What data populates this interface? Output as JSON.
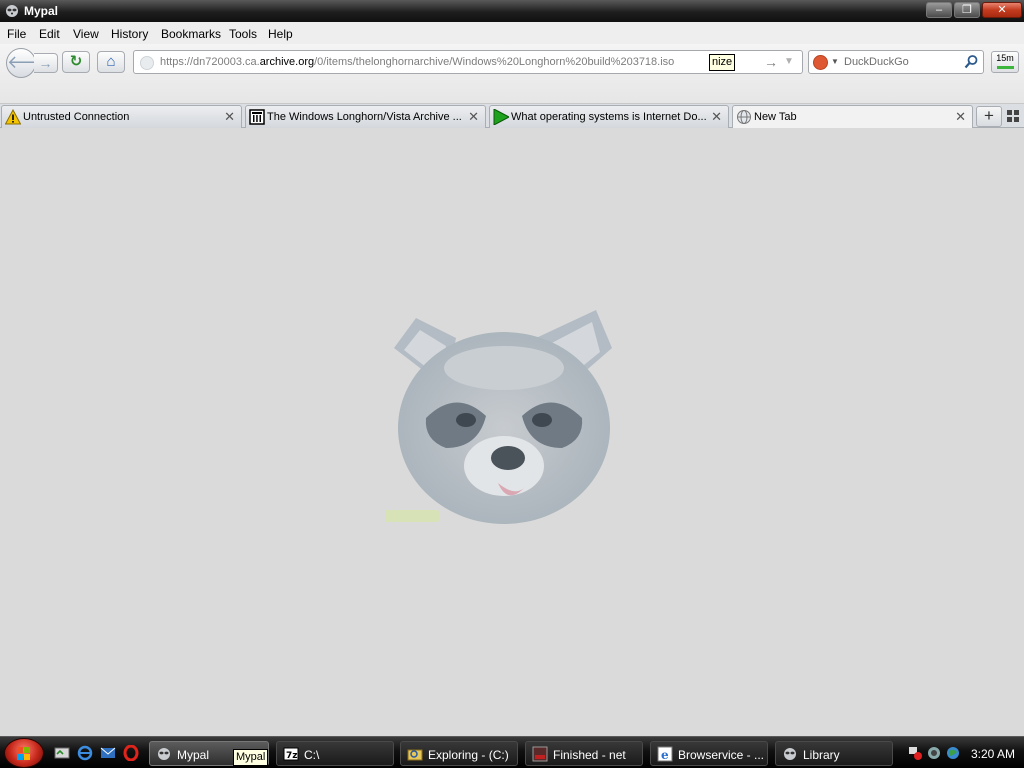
{
  "window": {
    "title": "Mypal",
    "buttons": {
      "minimize": "–",
      "restore": "❐",
      "close": "✕"
    }
  },
  "menubar": {
    "items": [
      "File",
      "Edit",
      "View",
      "History",
      "Bookmarks",
      "Tools",
      "Help"
    ]
  },
  "navbar": {
    "back_glyph": "🡐",
    "forward_glyph": "→",
    "reload_glyph": "↻",
    "home_glyph": "⌂",
    "url_prefix": "https://dn720003.ca.",
    "url_host": "archive.org",
    "url_path": "/0/items/thelonghornarchive/Windows%20Longhorn%20build%203718.iso",
    "url_tooltip": "nize",
    "go_glyph": "→",
    "dropdown_glyph": "▼",
    "search_placeholder": "DuckDuckGo",
    "addon_label": "15m"
  },
  "tabs": [
    {
      "label": "Untrusted Connection",
      "icon": "warning-icon",
      "active": false
    },
    {
      "label": "The Windows Longhorn/Vista Archive ...",
      "icon": "archive-icon",
      "active": false
    },
    {
      "label": "What operating systems is Internet Do...",
      "icon": "play-arrow-icon",
      "active": false
    },
    {
      "label": "New Tab",
      "icon": "globe-icon",
      "active": true
    }
  ],
  "tab_close_glyph": "✕",
  "newtab_glyph": "+",
  "taskbar": {
    "tasks": [
      {
        "label": "Mypal",
        "icon": "raccoon-icon",
        "active": true
      },
      {
        "label": "C:\\",
        "icon": "7zip-icon",
        "active": false
      },
      {
        "label": "Exploring - (C:)",
        "icon": "explorer-icon",
        "active": false
      },
      {
        "label": "Finished - net",
        "icon": "downloader-icon",
        "active": false
      },
      {
        "label": "Browservice - ...",
        "icon": "ie-icon",
        "active": false
      },
      {
        "label": "Library",
        "icon": "raccoon-icon",
        "active": false
      }
    ],
    "tooltip": "Mypal",
    "clock": "3:20 AM"
  },
  "colors": {
    "content_bg": "#dadada",
    "titlebar": "#1e1e1e",
    "taskbar": "#111111"
  }
}
